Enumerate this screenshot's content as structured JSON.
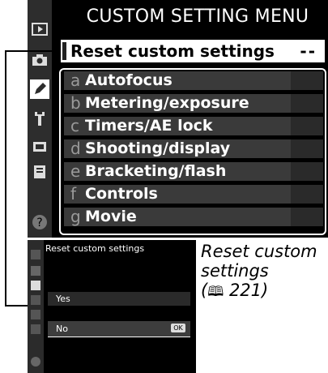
{
  "main": {
    "title": "CUSTOM SETTING MENU",
    "reset_label": "Reset custom settings",
    "reset_value": "--",
    "items": [
      {
        "letter": "a",
        "label": "Autofocus"
      },
      {
        "letter": "b",
        "label": "Metering/exposure"
      },
      {
        "letter": "c",
        "label": "Timers/AE lock"
      },
      {
        "letter": "d",
        "label": "Shooting/display"
      },
      {
        "letter": "e",
        "label": "Bracketing/flash"
      },
      {
        "letter": "f",
        "label": "Controls"
      },
      {
        "letter": "g",
        "label": "Movie"
      }
    ],
    "sidebar_icons": [
      "playback-icon",
      "camera-icon",
      "pencil-icon",
      "wrench-icon",
      "retouch-icon",
      "my-menu-icon",
      "help-icon"
    ]
  },
  "thumbnail": {
    "title": "Reset custom settings",
    "yes_label": "Yes",
    "no_label": "No",
    "ok_label": "OK"
  },
  "caption": {
    "line1": "Reset custom",
    "line2": "settings",
    "ref": "221"
  }
}
